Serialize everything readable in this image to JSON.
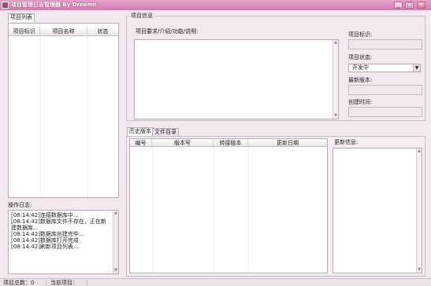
{
  "window": {
    "title": "项目管理日志管理器 By Dreamn",
    "buttons": {
      "minimize": "_",
      "maximize": "□",
      "close": "✕"
    }
  },
  "project_list": {
    "tab_label": "项目列表",
    "columns": [
      "项目标识",
      "项目名称",
      "状态"
    ],
    "rows": []
  },
  "operation_log": {
    "title": "操作日志:",
    "lines": [
      "[08:14:42]连接数据库中...",
      "[08:14:42]数据库文件不存在，正在新建数据库...",
      "[08:14:42]数据库创建完毕...",
      "[08:14:42]数据库打开完成",
      "[08:14:42]刷新项目列表..."
    ]
  },
  "project_info": {
    "group_title": "项目信息",
    "requirements_label": "项目要求/介绍/功能/说明:",
    "requirements_value": "",
    "id_label": "项目标识:",
    "id_value": "",
    "status_label": "项目状态:",
    "status_value": "开发中",
    "latest_version_label": "最新版本:",
    "latest_version_value": "",
    "created_label": "创建时间:",
    "created_value": ""
  },
  "history": {
    "tabs": [
      "历史版本",
      "文件目录"
    ],
    "active_tab": 0,
    "columns": [
      "编号",
      "版本号",
      "转接版本",
      "更新日期"
    ],
    "rows": [],
    "update_info_label": "更新信息:",
    "update_info_value": ""
  },
  "statusbar": {
    "project_count": "项目总数：0",
    "current_project": "当前项目："
  },
  "colors": {
    "titlebar": "#d27db1",
    "window_bg": "#f1e9ef",
    "border": "#b7aab3"
  }
}
